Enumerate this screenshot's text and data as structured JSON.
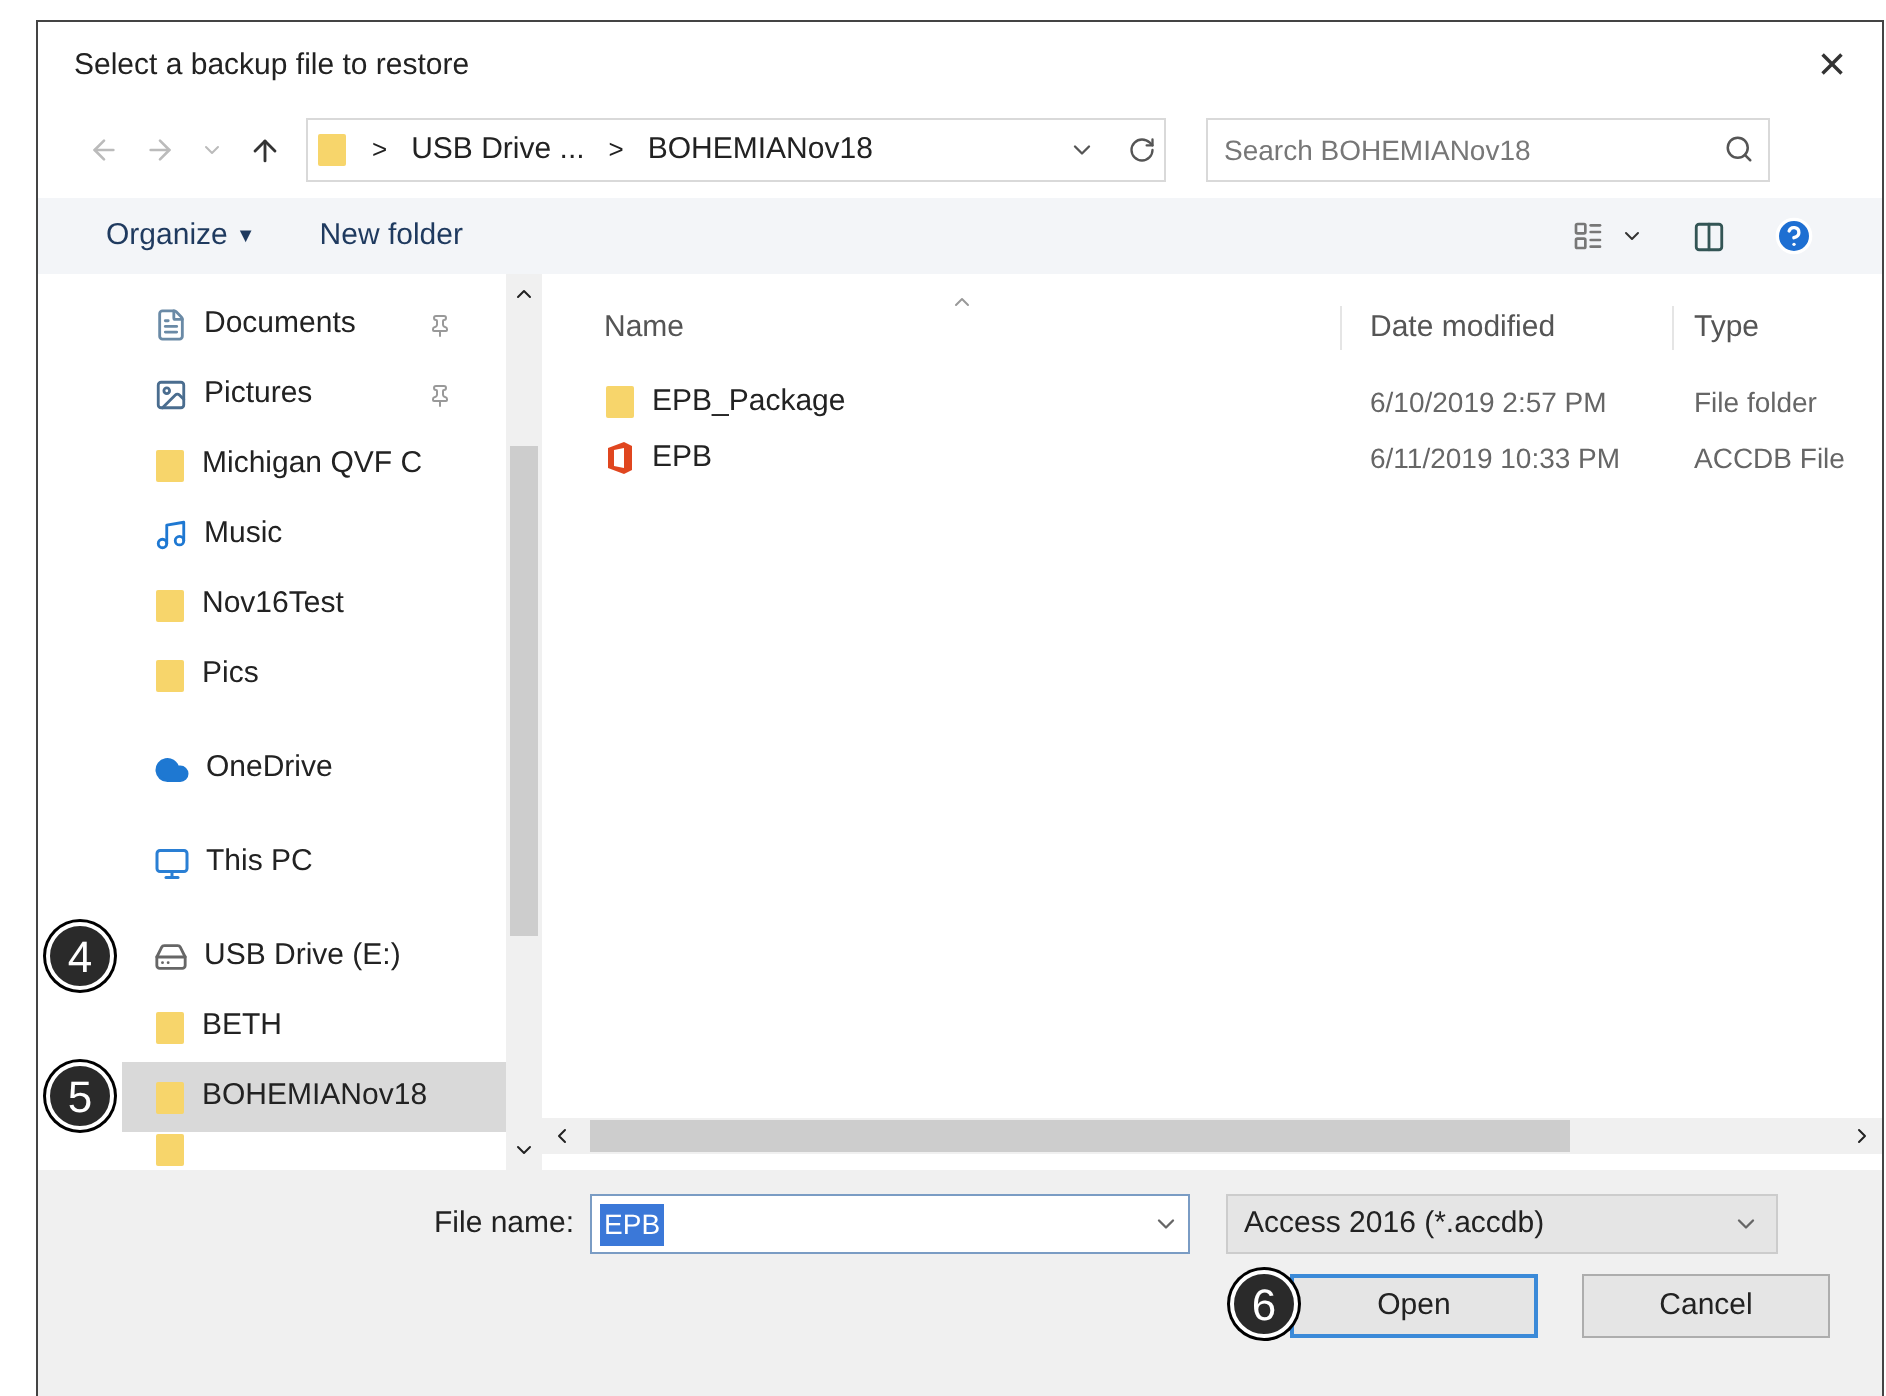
{
  "window": {
    "title": "Select a backup file to restore",
    "close": "×"
  },
  "address_bar": {
    "segments": [
      "USB Drive ...",
      "BOHEMIANov18"
    ],
    "separator": ">"
  },
  "search": {
    "placeholder": "Search BOHEMIANov18"
  },
  "toolbar": {
    "organize": "Organize",
    "organize_caret": "▼",
    "new_folder": "New folder"
  },
  "sidebar": {
    "items": [
      {
        "label": "Documents",
        "kind": "documents",
        "pinned": true,
        "selected": false
      },
      {
        "label": "Pictures",
        "kind": "pictures",
        "pinned": true,
        "selected": false
      },
      {
        "label": "Michigan QVF C",
        "kind": "folder",
        "pinned": false,
        "selected": false
      },
      {
        "label": "Music",
        "kind": "music",
        "pinned": false,
        "selected": false
      },
      {
        "label": "Nov16Test",
        "kind": "folder",
        "pinned": false,
        "selected": false
      },
      {
        "label": "Pics",
        "kind": "folder",
        "pinned": false,
        "selected": false
      },
      {
        "label": "OneDrive",
        "kind": "cloud",
        "pinned": false,
        "selected": false
      },
      {
        "label": "This PC",
        "kind": "pc",
        "pinned": false,
        "selected": false
      },
      {
        "label": "USB Drive (E:)",
        "kind": "drive",
        "pinned": false,
        "selected": false,
        "callout": "4"
      },
      {
        "label": "BETH",
        "kind": "folder",
        "pinned": false,
        "selected": false
      },
      {
        "label": "BOHEMIANov18",
        "kind": "folder",
        "pinned": false,
        "selected": true,
        "callout": "5"
      }
    ]
  },
  "table": {
    "columns": [
      "Name",
      "Date modified",
      "Type"
    ],
    "rows": [
      {
        "name": "EPB_Package",
        "kind": "folder",
        "date": "6/10/2019 2:57 PM",
        "type": "File folder"
      },
      {
        "name": "EPB",
        "kind": "access",
        "date": "6/11/2019 10:33 PM",
        "type": "ACCDB File"
      }
    ]
  },
  "file_name": {
    "label": "File name:",
    "value": "EPB"
  },
  "file_type": {
    "value": "Access 2016 (*.accdb)"
  },
  "buttons": [
    {
      "label": "Open",
      "default": true,
      "callout": "6"
    },
    {
      "label": "Cancel",
      "default": false
    }
  ]
}
